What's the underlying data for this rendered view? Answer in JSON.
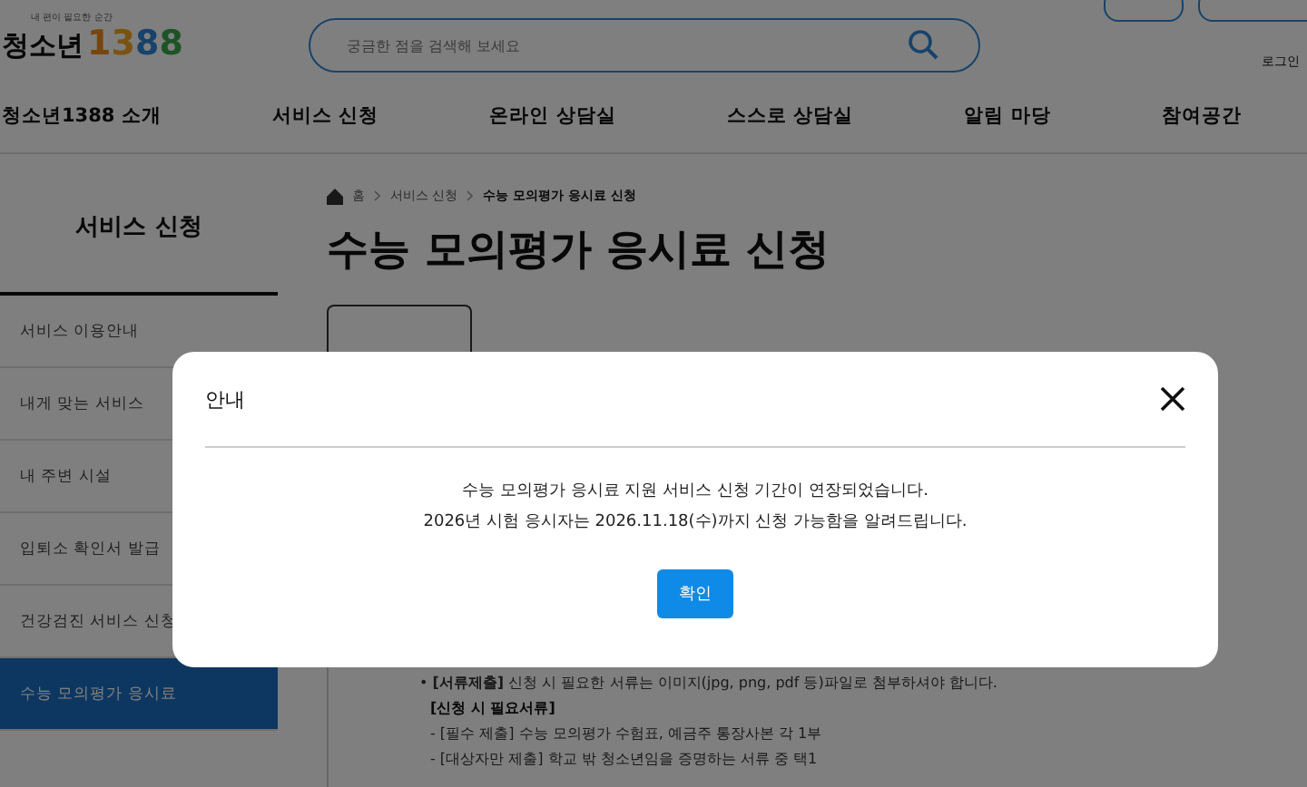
{
  "header": {
    "logo": {
      "tagline": "내 편이 필요한 순간",
      "name": "청소년",
      "number": "1388"
    },
    "search": {
      "placeholder": "궁금한 점을 검색해 보세요"
    },
    "login": "로그인"
  },
  "nav": [
    "청소년1388 소개",
    "서비스 신청",
    "온라인 상담실",
    "스스로 상담실",
    "알림 마당",
    "참여공간"
  ],
  "sidebar": {
    "title": "서비스 신청",
    "items": [
      {
        "label": "서비스 이용안내",
        "selected": false
      },
      {
        "label": "내게 맞는 서비스",
        "selected": false
      },
      {
        "label": "내 주변 시설",
        "selected": false
      },
      {
        "label": "입퇴소 확인서 발급",
        "selected": false
      },
      {
        "label": "건강검진 서비스 신청",
        "selected": false
      },
      {
        "label": "수능 모의평가 응시료",
        "selected": true
      }
    ]
  },
  "breadcrumb": [
    "홈",
    "서비스 신청",
    "수능 모의평가 응시료 신청"
  ],
  "page_title": "수능 모의평가 응시료 신청",
  "content": [
    {
      "kind": "bullet",
      "text": "• **[서류제출]** 신청 시 필요한 서류는 이미지(jpg, png, pdf 등)파일로 첨부하셔야 합니다."
    },
    {
      "kind": "heading",
      "text": "[신청 시 필요서류]"
    },
    {
      "kind": "dash",
      "text": "- [필수 제출] 수능 모의평가 수험표, 예금주 통장사본 각 1부"
    },
    {
      "kind": "dash",
      "text": "- [대상자만 제출] 학교 밖 청소년임을 증명하는 서류 중 택1"
    }
  ],
  "modal": {
    "title": "안내",
    "message": [
      "수능 모의평가 응시료 지원 서비스 신청 기간이 연장되었습니다.",
      "2026년 시험 응시자는 2026.11.18(수)까지 신청 가능함을 알려드립니다."
    ],
    "confirm": "확인"
  }
}
